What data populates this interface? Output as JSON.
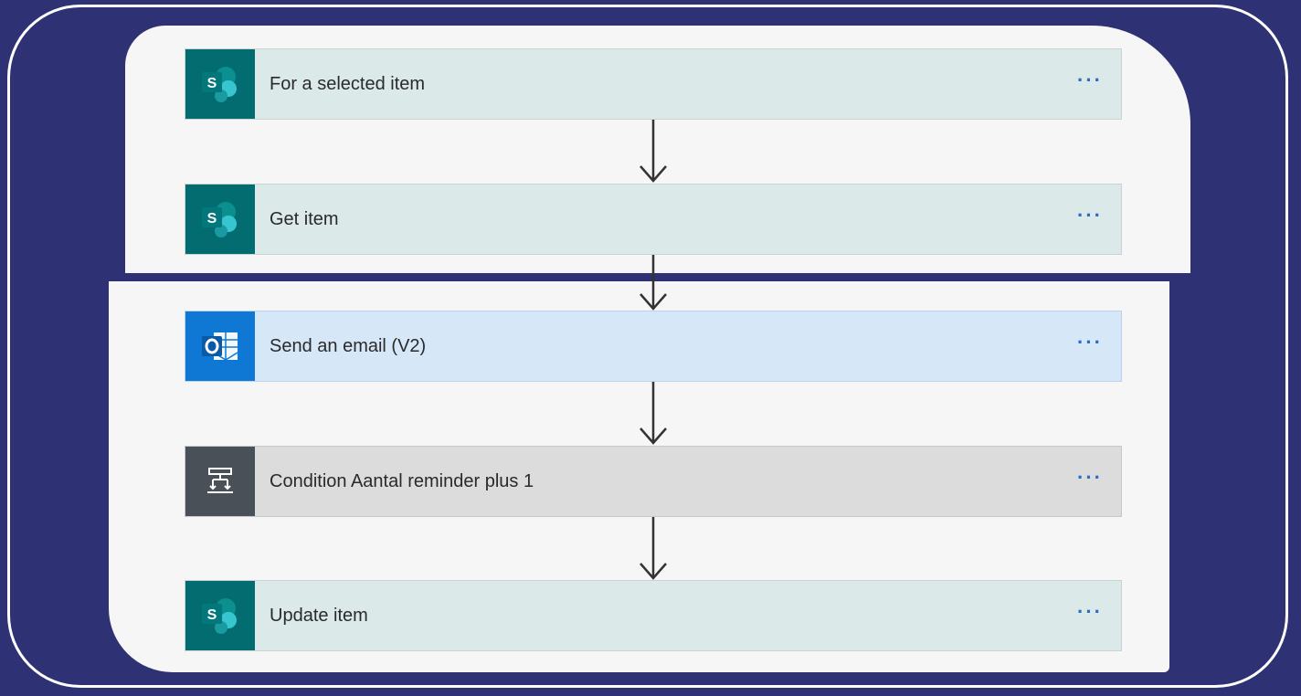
{
  "flow": {
    "steps": [
      {
        "label": "For a selected item",
        "icon": "sharepoint-icon",
        "more": "···"
      },
      {
        "label": "Get item",
        "icon": "sharepoint-icon",
        "more": "···"
      },
      {
        "label": "Send an email (V2)",
        "icon": "outlook-icon",
        "more": "···"
      },
      {
        "label": "Condition Aantal reminder plus 1",
        "icon": "condition-icon",
        "more": "···"
      },
      {
        "label": "Update item",
        "icon": "sharepoint-icon",
        "more": "···"
      }
    ]
  },
  "colors": {
    "background": "#2e3174",
    "sharepoint": "#036c70",
    "outlook": "#0f78d4",
    "condition": "#4a5058",
    "more_dots": "#2b6cc4"
  }
}
